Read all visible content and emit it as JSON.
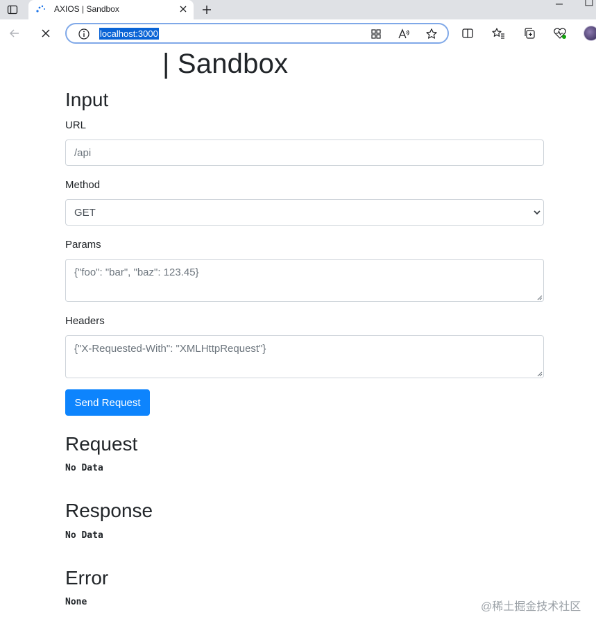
{
  "browser": {
    "tab": {
      "title": "AXIOS | Sandbox"
    },
    "address_bar": {
      "url": "localhost:3000"
    },
    "colors": {
      "tabstrip": "#dfe1e5",
      "address_border": "#7fa8e8",
      "selection": "#0a64d6"
    }
  },
  "page": {
    "title": "| Sandbox",
    "input_section": {
      "heading": "Input",
      "url": {
        "label": "URL",
        "value": "/api"
      },
      "method": {
        "label": "Method",
        "selected": "GET"
      },
      "params": {
        "label": "Params",
        "value": "{\"foo\": \"bar\", \"baz\": 123.45}"
      },
      "headers": {
        "label": "Headers",
        "value": "{\"X-Requested-With\": \"XMLHttpRequest\"}"
      },
      "submit_label": "Send Request"
    },
    "request_section": {
      "heading": "Request",
      "content": "No Data"
    },
    "response_section": {
      "heading": "Response",
      "content": "No Data"
    },
    "error_section": {
      "heading": "Error",
      "content": "None"
    },
    "colors": {
      "primary_button": "#0d84fd",
      "text": "#212529",
      "input_border": "#ced4da"
    }
  },
  "watermark": "@稀土掘金技术社区"
}
